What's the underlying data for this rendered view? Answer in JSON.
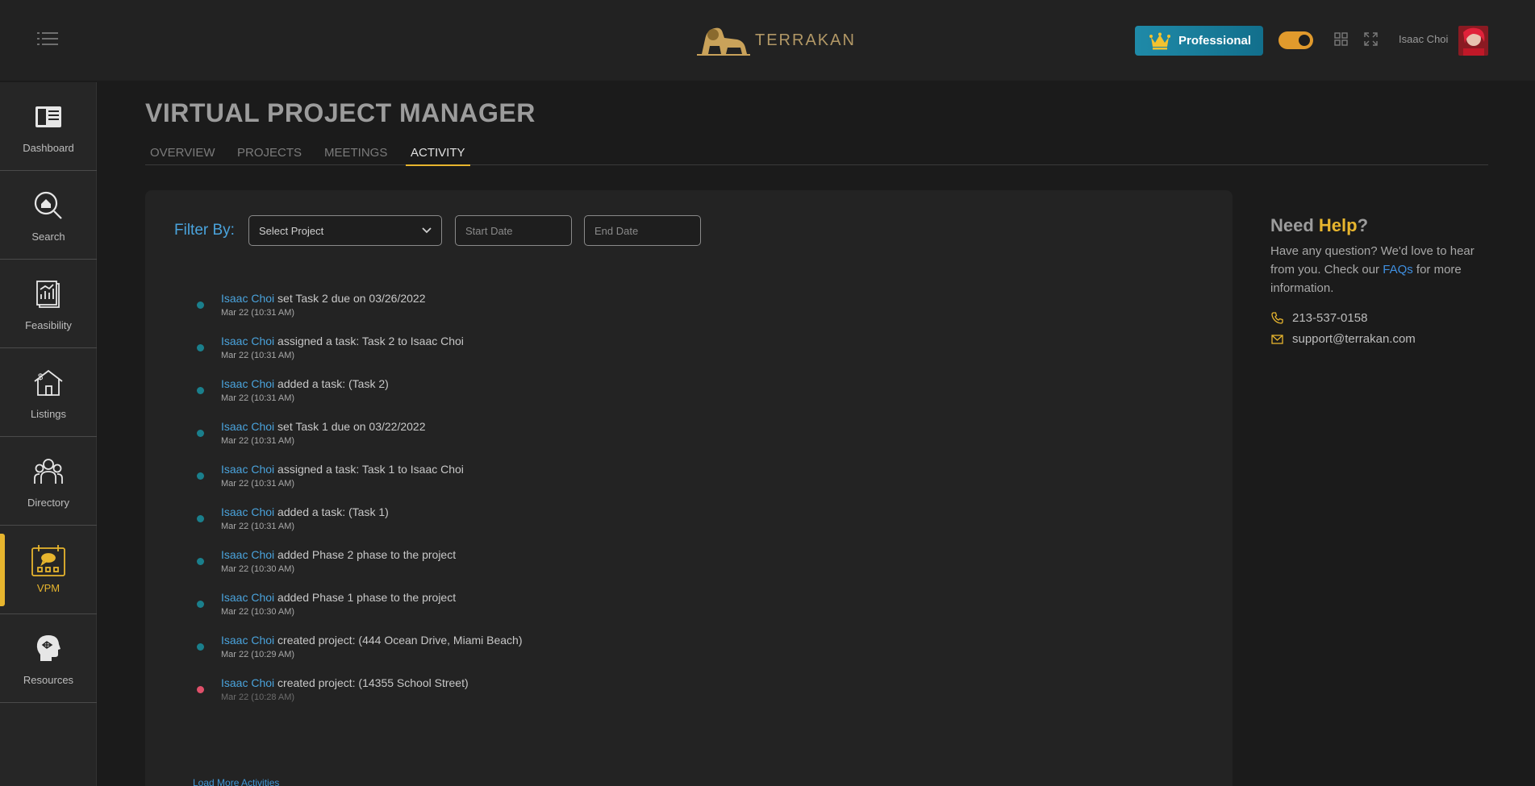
{
  "header": {
    "brand": "TERRAKAN",
    "plan_button": "Professional",
    "user_name": "Isaac Choi",
    "accent_color": "#e7b52e"
  },
  "sidebar": {
    "items": [
      {
        "label": "Dashboard",
        "icon": "dashboard-icon"
      },
      {
        "label": "Search",
        "icon": "search-home-icon"
      },
      {
        "label": "Feasibility",
        "icon": "feasibility-report-icon"
      },
      {
        "label": "Listings",
        "icon": "house-dollar-icon"
      },
      {
        "label": "Directory",
        "icon": "people-group-icon"
      },
      {
        "label": "VPM",
        "icon": "vpm-board-icon",
        "active": true
      },
      {
        "label": "Resources",
        "icon": "head-brain-icon"
      }
    ]
  },
  "page": {
    "title": "VIRTUAL PROJECT MANAGER",
    "tabs": [
      "OVERVIEW",
      "PROJECTS",
      "MEETINGS",
      "ACTIVITY"
    ],
    "active_tab": "ACTIVITY"
  },
  "filter": {
    "label": "Filter By:",
    "project_select": "Select Project",
    "start_placeholder": "Start Date",
    "end_placeholder": "End Date"
  },
  "activities": [
    {
      "user": "Isaac Choi",
      "text": "set Task 2 due on 03/26/2022",
      "time": "Mar 22 (10:31 AM)"
    },
    {
      "user": "Isaac Choi",
      "text": "assigned a task: Task 2 to Isaac Choi",
      "time": "Mar 22 (10:31 AM)"
    },
    {
      "user": "Isaac Choi",
      "text": "added a task: (Task 2)",
      "time": "Mar 22 (10:31 AM)"
    },
    {
      "user": "Isaac Choi",
      "text": "set Task 1 due on 03/22/2022",
      "time": "Mar 22 (10:31 AM)"
    },
    {
      "user": "Isaac Choi",
      "text": "assigned a task: Task 1 to Isaac Choi",
      "time": "Mar 22 (10:31 AM)"
    },
    {
      "user": "Isaac Choi",
      "text": "added a task: (Task 1)",
      "time": "Mar 22 (10:31 AM)"
    },
    {
      "user": "Isaac Choi",
      "text": "added Phase 2 phase to the project",
      "time": "Mar 22 (10:30 AM)"
    },
    {
      "user": "Isaac Choi",
      "text": "added Phase 1 phase to the project",
      "time": "Mar 22 (10:30 AM)"
    },
    {
      "user": "Isaac Choi",
      "text": "created project: (444 Ocean Drive, Miami Beach)",
      "time": "Mar 22 (10:29 AM)"
    },
    {
      "user": "Isaac Choi",
      "text": "created project: (14355 School Street)",
      "time": "Mar 22 (10:28 AM)"
    }
  ],
  "load_more": "Load More Activities",
  "help": {
    "title_prefix": "Need",
    "title_highlight": "Help",
    "title_suffix": "?",
    "text_before": "Have any question? We'd love to hear from you. Check our",
    "faq_link": "FAQs",
    "text_after": "for more information.",
    "phone": "213-537-0158",
    "email": "support@terrakan.com"
  }
}
